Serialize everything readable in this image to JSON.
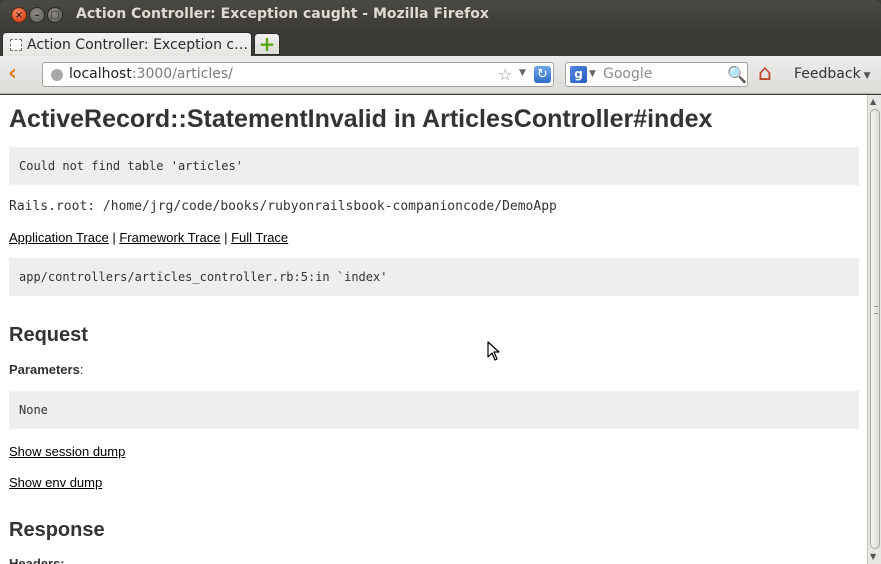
{
  "window": {
    "title": "Action Controller: Exception caught - Mozilla Firefox",
    "close_glyph": "×",
    "min_glyph": "–",
    "max_glyph": "□"
  },
  "tabs": [
    {
      "label": "Action Controller: Exception c…",
      "favicon": "blank-page-icon"
    }
  ],
  "new_tab_glyph": "+",
  "nav": {
    "back_glyph": "‹",
    "url_host": "localhost",
    "url_path": ":3000/articles/",
    "star_glyph": "☆",
    "dropdown_glyph": "▼",
    "reload_glyph": "↻",
    "search_engine_glyph": "g",
    "search_placeholder": "Google",
    "search_glyph": "🔍",
    "home_glyph": "⌂",
    "feedback_label": "Feedback"
  },
  "page": {
    "title": "ActiveRecord::StatementInvalid in ArticlesController#index",
    "error_message": "Could not find table 'articles'",
    "rails_root": "Rails.root: /home/jrg/code/books/rubyonrailsbook-companioncode/DemoApp",
    "trace_links": [
      "Application Trace",
      "Framework Trace",
      "Full Trace"
    ],
    "trace_separator": " | ",
    "trace_line": "app/controllers/articles_controller.rb:5:in `index'",
    "request_heading": "Request",
    "parameters_label": "Parameters",
    "parameters_colon": ":",
    "parameters_value": "None",
    "show_session_dump": "Show session dump",
    "show_env_dump": "Show env dump",
    "response_heading": "Response",
    "headers_label": "Headers:"
  },
  "scrollbar": {
    "up_glyph": "▲",
    "down_glyph": "▼"
  },
  "colors": {
    "titlebar": "#3c3b37",
    "back_arrow": "#e07a1d",
    "pre_background": "#eeeeee",
    "new_tab_plus": "#5aa818"
  }
}
